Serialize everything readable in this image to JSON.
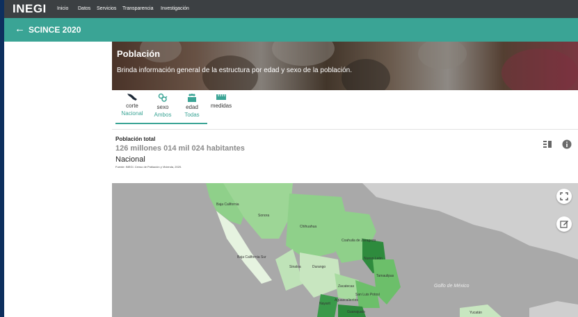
{
  "topnav": {
    "logo": "INEGI",
    "items": [
      {
        "label": "Inicio"
      },
      {
        "label": "Datos"
      },
      {
        "label": "Servicios"
      },
      {
        "label": "Transparencia"
      },
      {
        "label": "Investigación"
      }
    ]
  },
  "titlebar": {
    "back_icon": "arrow-left-icon",
    "title": "SCINCE 2020"
  },
  "hero": {
    "title": "Población",
    "subtitle": "Brinda información general de la estructura por edad y sexo de la población."
  },
  "controls": [
    {
      "icon": "mexico-map-icon",
      "label": "corte",
      "value": "Nacional"
    },
    {
      "icon": "gender-icon",
      "label": "sexo",
      "value": "Ambos"
    },
    {
      "icon": "age-group-icon",
      "label": "edad",
      "value": "Todas"
    },
    {
      "icon": "ruler-icon",
      "label": "medidas",
      "value": ""
    }
  ],
  "stat": {
    "label": "Población total",
    "value": "126 millones 014 mil 024 habitantes",
    "scope": "Nacional",
    "source": "Fuente: INEGI. Censo de Población y Vivienda, 2020."
  },
  "map": {
    "labels": [
      {
        "text": "Baja California"
      },
      {
        "text": "Sonora"
      },
      {
        "text": "Chihuahua"
      },
      {
        "text": "Coahuila de Zaragoza"
      },
      {
        "text": "Nuevo León"
      },
      {
        "text": "Baja California Sur"
      },
      {
        "text": "Sinaloa"
      },
      {
        "text": "Durango"
      },
      {
        "text": "Tamaulipas"
      },
      {
        "text": "Zacatecas"
      },
      {
        "text": "San Luis Potosí"
      },
      {
        "text": "Aguascalientes"
      },
      {
        "text": "Nayarit"
      },
      {
        "text": "Guanajuato"
      },
      {
        "text": "Golfo de México"
      },
      {
        "text": "Yucatán"
      }
    ],
    "colors": {
      "water": "#a9a9a9",
      "land": "#cfcfcf",
      "light": "#c8e6c0",
      "mid": "#8fd08a",
      "dark": "#3a9a4a",
      "darker": "#2e8b3d"
    }
  },
  "tools": {
    "table_icon": "table-view-icon",
    "info_icon": "info-icon",
    "fullscreen_icon": "fullscreen-icon",
    "edit_icon": "edit-icon"
  },
  "colors": {
    "nav": "#3c4043",
    "accent": "#3aa495",
    "background": "#0d2f5e"
  }
}
